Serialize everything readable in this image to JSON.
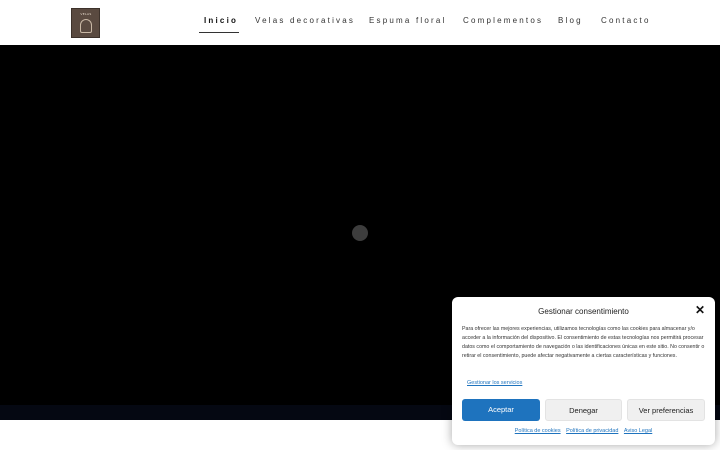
{
  "logo": {
    "text": "VELAS"
  },
  "nav": {
    "items": [
      {
        "label": "Inicio"
      },
      {
        "label": "Velas decorativas"
      },
      {
        "label": "Espuma floral"
      },
      {
        "label": "Complementos"
      },
      {
        "label": "Blog"
      },
      {
        "label": "Contacto"
      }
    ],
    "active": "Inicio"
  },
  "consent": {
    "title": "Gestionar consentimiento",
    "body": "Para ofrecer las mejores experiencias, utilizamos tecnologías como las cookies para almacenar y/o acceder a la información del dispositivo. El consentimiento de estas tecnologías nos permitirá procesar datos como el comportamiento de navegación o las identificaciones únicas en este sitio. No consentir o retirar el consentimiento, puede afectar negativamente a ciertas características y funciones.",
    "manage_link": "Gestionar los servicios",
    "accept_label": "Aceptar",
    "deny_label": "Denegar",
    "prefs_label": "Ver preferencias",
    "links": {
      "cookies": "Política de cookies",
      "privacy": "Política de privacidad",
      "legal": "Aviso Legal"
    }
  },
  "colors": {
    "accent": "#1e73be",
    "hero_bg": "#000000",
    "logo_bg": "#5a4a40"
  }
}
